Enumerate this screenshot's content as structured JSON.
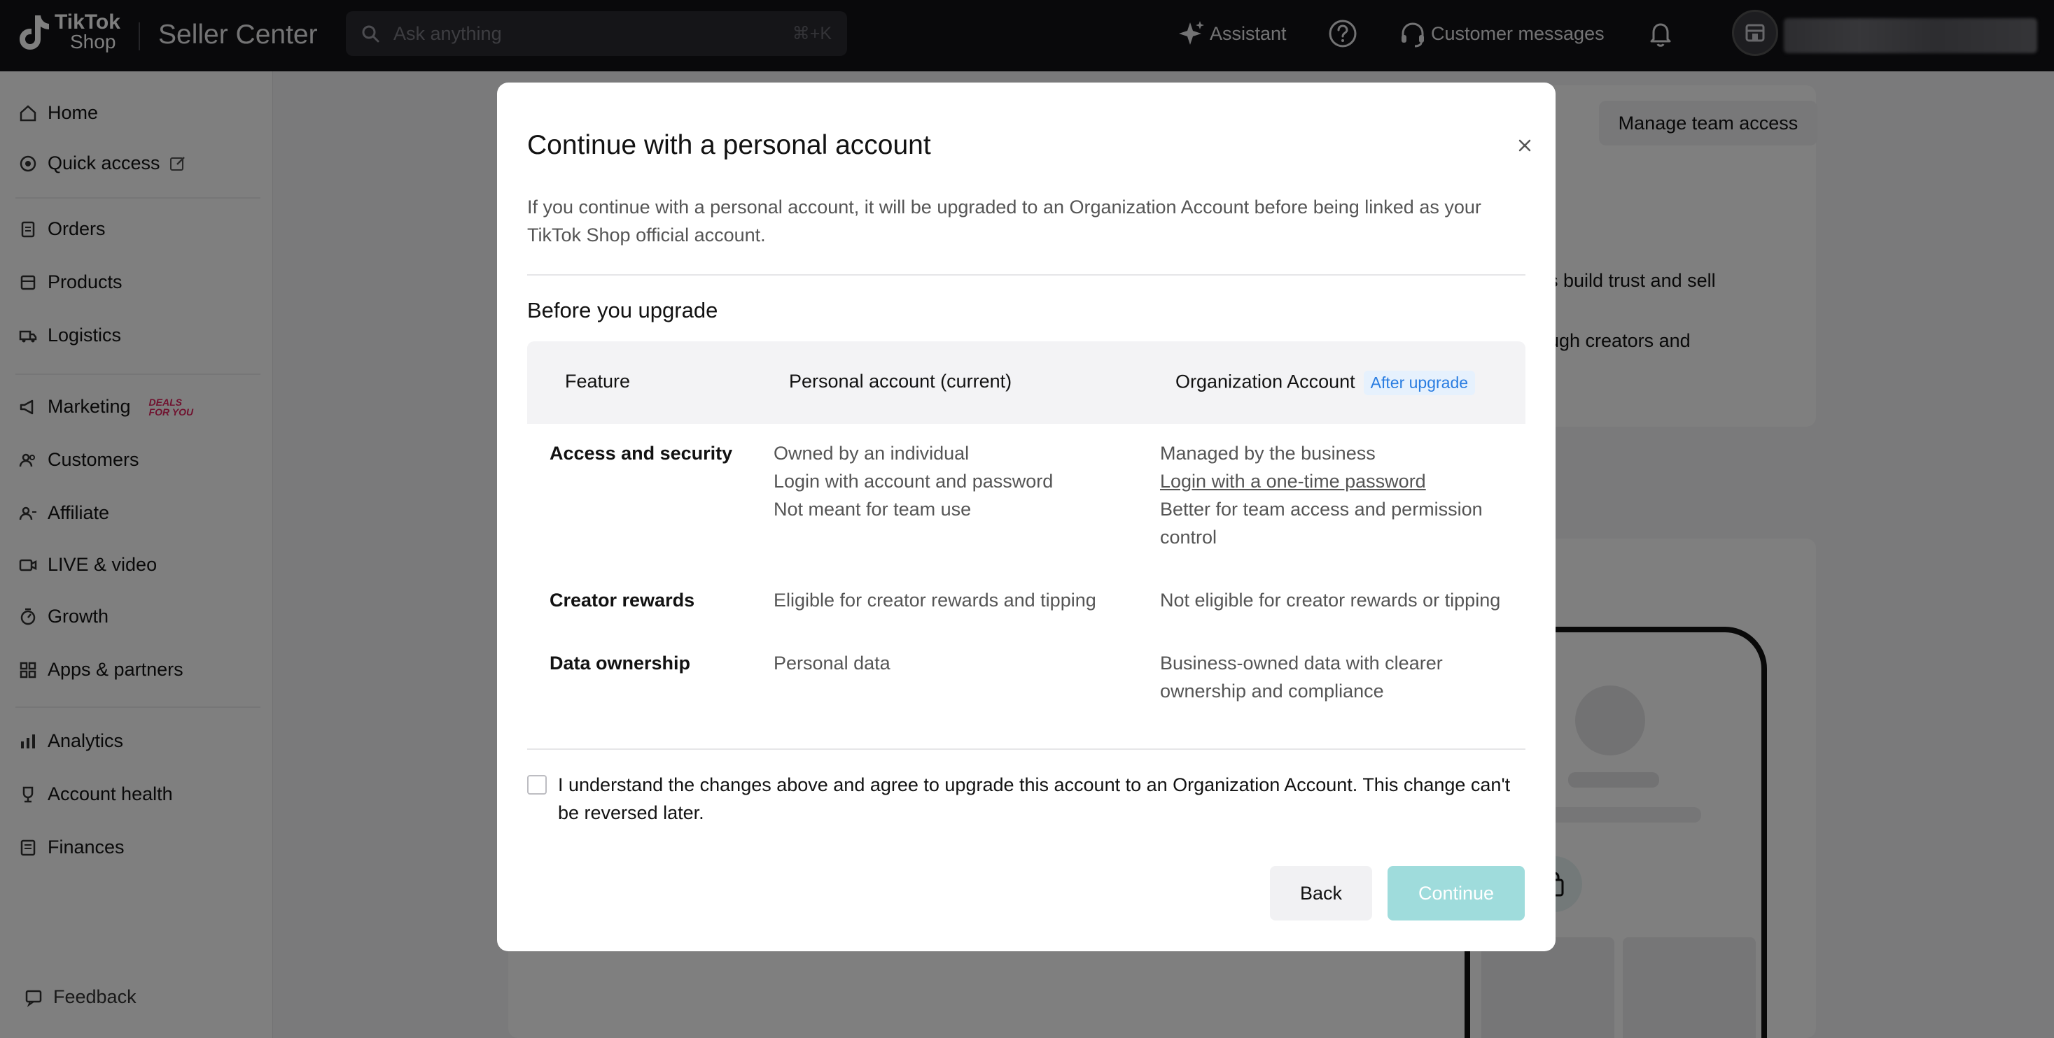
{
  "topbar": {
    "logo_line1": "TikTok",
    "logo_line2": "Shop",
    "app_title": "Seller Center",
    "search_placeholder": "Ask anything",
    "search_shortcut": "⌘+K",
    "assistant_label": "Assistant",
    "messages_label": "Customer messages"
  },
  "sidebar": {
    "items": [
      {
        "label": "Home",
        "icon": "home-icon"
      },
      {
        "label": "Quick access",
        "icon": "quick-access-icon"
      },
      {
        "label": "Orders",
        "icon": "orders-icon"
      },
      {
        "label": "Products",
        "icon": "products-icon"
      },
      {
        "label": "Logistics",
        "icon": "truck-icon"
      },
      {
        "label": "Marketing",
        "icon": "megaphone-icon"
      },
      {
        "label": "Customers",
        "icon": "customers-icon"
      },
      {
        "label": "Affiliate",
        "icon": "affiliate-icon"
      },
      {
        "label": "LIVE & video",
        "icon": "video-icon"
      },
      {
        "label": "Growth",
        "icon": "growth-icon"
      },
      {
        "label": "Apps & partners",
        "icon": "apps-icon"
      },
      {
        "label": "Analytics",
        "icon": "analytics-icon"
      },
      {
        "label": "Account health",
        "icon": "trophy-icon"
      },
      {
        "label": "Finances",
        "icon": "finances-icon"
      }
    ],
    "deals_badge_line1": "DEALS",
    "deals_badge_line2": "FOR YOU",
    "feedback_label": "Feedback"
  },
  "background": {
    "manage_team_access": "Manage team access",
    "text_1": "s build trust and sell",
    "text_2": "ugh creators and"
  },
  "modal": {
    "title": "Continue with a personal account",
    "description": "If you continue with a personal account, it will be upgraded to an Organization Account before being linked as your TikTok Shop official account.",
    "section_title": "Before you upgrade",
    "table": {
      "headers": {
        "feature": "Feature",
        "personal": "Personal account (current)",
        "organization": "Organization Account",
        "after_badge": "After upgrade"
      },
      "rows": [
        {
          "feature": "Access and security",
          "personal": [
            "Owned by an individual",
            "Login with account and password",
            "Not meant for team use"
          ],
          "organization_1": "Managed by the business",
          "organization_link": "Login with a one-time password",
          "organization_2": "Better for team access and permission control"
        },
        {
          "feature": "Creator rewards",
          "personal": [
            "Eligible for creator rewards and tipping"
          ],
          "organization_1": "Not eligible for creator rewards or tipping"
        },
        {
          "feature": "Data ownership",
          "personal": [
            "Personal data"
          ],
          "organization_1": "Business-owned data with clearer ownership and compliance"
        }
      ]
    },
    "agreement_text": "I understand the changes above and agree to upgrade this account to an Organization Account. This change can't be reversed later.",
    "agreement_checked": false,
    "back_label": "Back",
    "continue_label": "Continue",
    "continue_color": "#9fdcdc"
  }
}
